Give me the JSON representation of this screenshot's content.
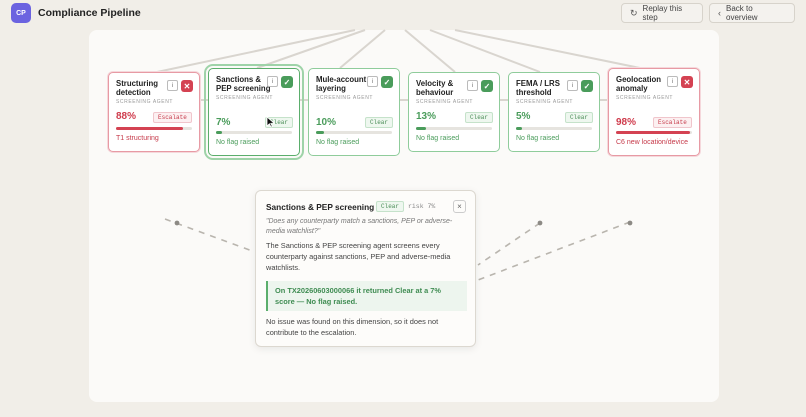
{
  "app": {
    "logo": "CP",
    "title": "Compliance Pipeline"
  },
  "toolbar": {
    "replay_label": "Replay this step",
    "replay_icon": "refresh-icon",
    "back_label": "Back to overview",
    "back_icon": "chevron-left-icon"
  },
  "agents": [
    {
      "title": "Structuring detection",
      "subtitle": "SCREENING AGENT",
      "status": "escalate",
      "percent": "88%",
      "tag": "Escalate",
      "score_fraction": 0.88,
      "note": "T1 structuring"
    },
    {
      "title": "Sanctions & PEP screening",
      "subtitle": "SCREENING AGENT",
      "status": "clear",
      "percent": "7%",
      "tag": "Clear",
      "score_fraction": 0.07,
      "note": "No flag raised",
      "selected": true
    },
    {
      "title": "Mule-account layering",
      "subtitle": "SCREENING AGENT",
      "status": "clear",
      "percent": "10%",
      "tag": "Clear",
      "score_fraction": 0.1,
      "note": "No flag raised"
    },
    {
      "title": "Velocity & behaviour",
      "subtitle": "SCREENING AGENT",
      "status": "clear",
      "percent": "13%",
      "tag": "Clear",
      "score_fraction": 0.13,
      "note": "No flag raised"
    },
    {
      "title": "FEMA / LRS threshold",
      "subtitle": "SCREENING AGENT",
      "status": "clear",
      "percent": "5%",
      "tag": "Clear",
      "score_fraction": 0.05,
      "note": "No flag raised"
    },
    {
      "title": "Geolocation anomaly",
      "subtitle": "SCREENING AGENT",
      "status": "escalate",
      "percent": "98%",
      "tag": "Escalate",
      "score_fraction": 0.98,
      "note": "C6 new location/device"
    }
  ],
  "detail": {
    "title": "Sanctions & PEP screening",
    "tag": "Clear",
    "risk": "risk 7%",
    "question": "\"Does any counterparty match a sanctions, PEP or adverse-media watchlist?\"",
    "description": "The Sanctions & PEP screening agent screens every counterparty against sanctions, PEP and adverse-media watchlists.",
    "result": "On TX20260603000066 it returned Clear at a 7% score — No flag raised.",
    "footer": "No issue was found on this dimension, so it does not contribute to the escalation."
  },
  "colors": {
    "accent": "#6b63e0",
    "clear": "#4a9c5b",
    "escalate": "#d44252"
  }
}
